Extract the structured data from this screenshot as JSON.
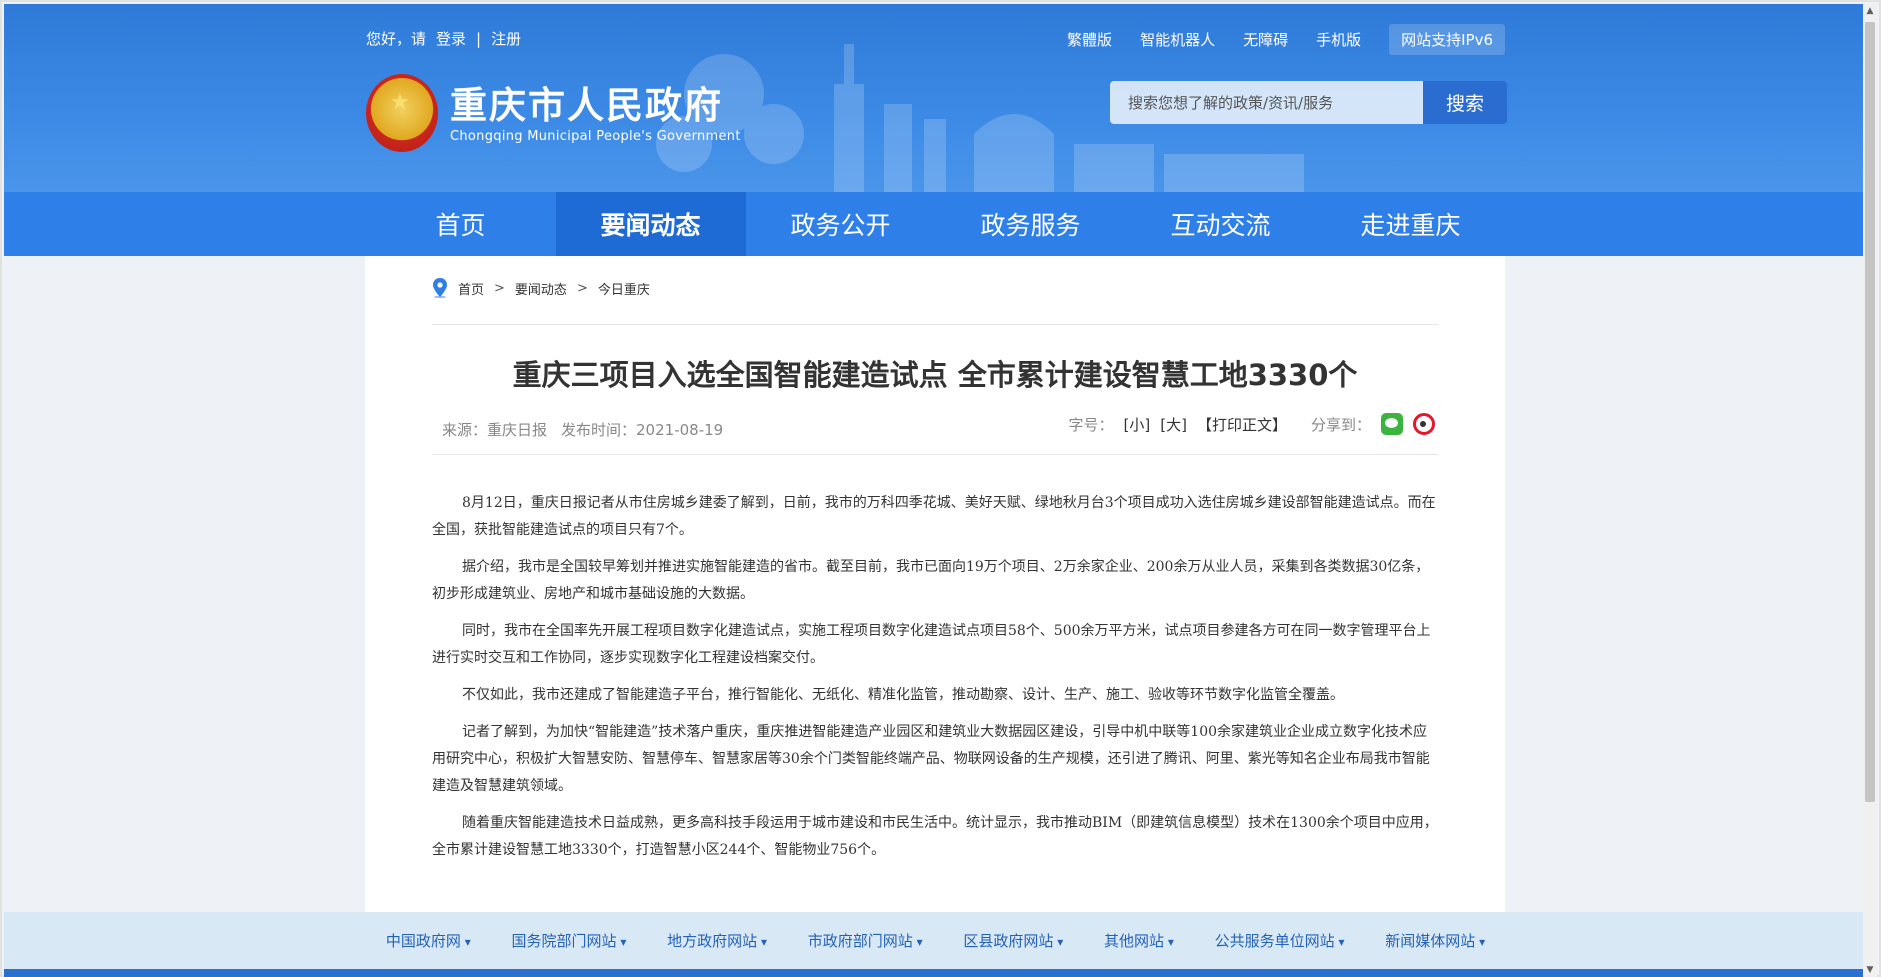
{
  "topbar": {
    "greeting": "您好，请",
    "login": "登录",
    "separator": "|",
    "register": "注册",
    "links": [
      "繁體版",
      "智能机器人",
      "无障碍",
      "手机版"
    ],
    "ipv6": "网站支持IPv6"
  },
  "logo": {
    "cn": "重庆市人民政府",
    "en": "Chongqing Municipal People's Government"
  },
  "search": {
    "placeholder": "搜索您想了解的政策/资讯/服务",
    "button": "搜索"
  },
  "nav": {
    "items": [
      "首页",
      "要闻动态",
      "政务公开",
      "政务服务",
      "互动交流",
      "走进重庆"
    ],
    "active_index": 1
  },
  "breadcrumb": {
    "items": [
      "首页",
      "要闻动态",
      "今日重庆"
    ],
    "sep": ">"
  },
  "article": {
    "title": "重庆三项目入选全国智能建造试点 全市累计建设智慧工地3330个",
    "source": "来源：重庆日报",
    "date": "发布时间：2021-08-19",
    "font_label": "字号：",
    "font_small": "[小]",
    "font_large": "[大]",
    "print": "【打印正文】",
    "share_label": "分享到：",
    "paragraphs": [
      "8月12日，重庆日报记者从市住房城乡建委了解到，日前，我市的万科四季花城、美好天赋、绿地秋月台3个项目成功入选住房城乡建设部智能建造试点。而在全国，获批智能建造试点的项目只有7个。",
      "据介绍，我市是全国较早筹划并推进实施智能建造的省市。截至目前，我市已面向19万个项目、2万余家企业、200余万从业人员，采集到各类数据30亿条，初步形成建筑业、房地产和城市基础设施的大数据。",
      "同时，我市在全国率先开展工程项目数字化建造试点，实施工程项目数字化建造试点项目58个、500余万平方米，试点项目参建各方可在同一数字管理平台上进行实时交互和工作协同，逐步实现数字化工程建设档案交付。",
      "不仅如此，我市还建成了智能建造子平台，推行智能化、无纸化、精准化监管，推动勘察、设计、生产、施工、验收等环节数字化监管全覆盖。",
      "记者了解到，为加快“智能建造”技术落户重庆，重庆推进智能建造产业园区和建筑业大数据园区建设，引导中机中联等100余家建筑业企业成立数字化技术应用研究中心，积极扩大智慧安防、智慧停车、智慧家居等30余个门类智能终端产品、物联网设备的生产规模，还引进了腾讯、阿里、紫光等知名企业布局我市智能建造及智慧建筑领域。",
      "随着重庆智能建造技术日益成熟，更多高科技手段运用于城市建设和市民生活中。统计显示，我市推动BIM（即建筑信息模型）技术在1300余个项目中应用，全市累计建设智慧工地3330个，打造智慧小区244个、智能物业756个。"
    ]
  },
  "footer": {
    "links": [
      "中国政府网",
      "国务院部门网站",
      "地方政府网站",
      "市政府部门网站",
      "区县政府网站",
      "其他网站",
      "公共服务单位网站",
      "新闻媒体网站"
    ]
  },
  "colors": {
    "header_blue": "#3c8ae6",
    "nav_blue": "#2f7fe8",
    "nav_active": "#1f6bd6",
    "footer_bg": "#d9e8f5",
    "link_blue": "#2462b8"
  }
}
